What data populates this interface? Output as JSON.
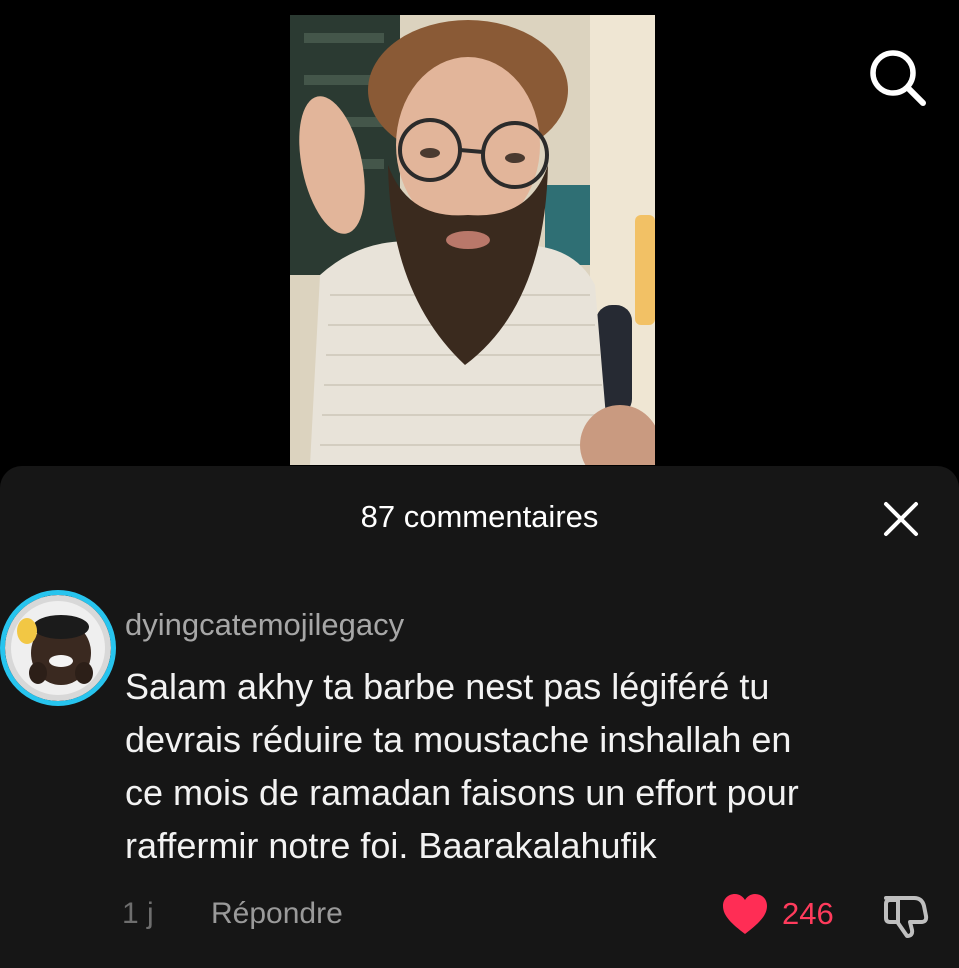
{
  "icons": {
    "search": "search-icon",
    "close": "close-icon",
    "like": "heart-icon",
    "dislike": "thumbs-down-icon"
  },
  "colors": {
    "background": "#000000",
    "sheet": "#161616",
    "like_accent": "#ff3b5c",
    "avatar_ring": "#27c4ee"
  },
  "comments_panel": {
    "title": "87 commentaires"
  },
  "comment": {
    "username": "dyingcatemojilegacy",
    "text_lines": [
      "Salam akhy ta barbe nest pas légiféré tu",
      "devrais réduire ta moustache inshallah en",
      "ce mois de ramadan faisons un effort pour",
      "raffermir notre foi. Baarakalahufik"
    ],
    "age": "1 j",
    "reply_label": "Répondre",
    "like_count": "246"
  }
}
